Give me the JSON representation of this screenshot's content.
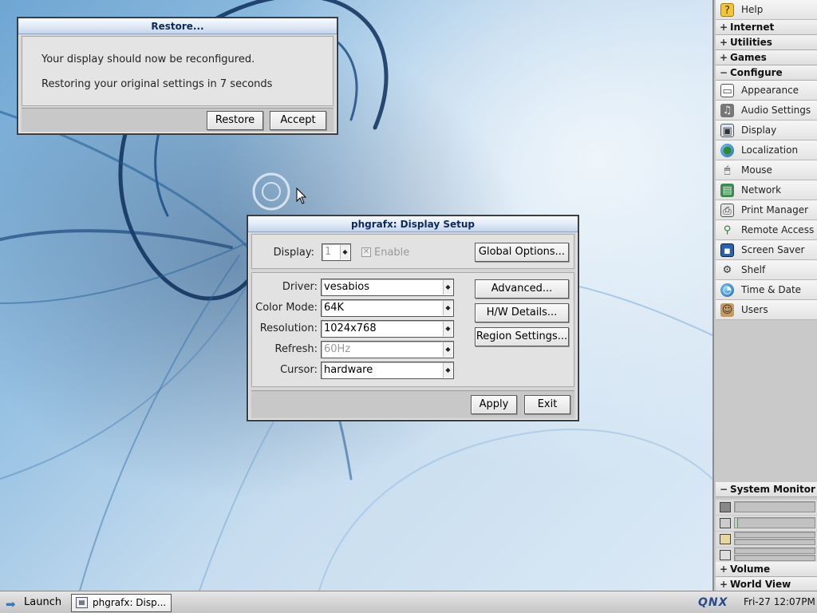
{
  "restore_dialog": {
    "title": "Restore...",
    "message_1": "Your display should now be reconfigured.",
    "message_2": "Restoring your original settings in 7 seconds",
    "restore_label": "Restore",
    "accept_label": "Accept"
  },
  "display_setup": {
    "title": "phgrafx: Display Setup",
    "display_label": "Display:",
    "display_value": "1",
    "enable_label": "Enable",
    "global_options_label": "Global Options...",
    "driver_label": "Driver:",
    "driver_value": "vesabios",
    "color_mode_label": "Color Mode:",
    "color_mode_value": "64K",
    "resolution_label": "Resolution:",
    "resolution_value": "1024x768",
    "refresh_label": "Refresh:",
    "refresh_value": "60Hz",
    "cursor_label": "Cursor:",
    "cursor_value": "hardware",
    "advanced_label": "Advanced...",
    "hw_details_label": "H/W Details...",
    "region_settings_label": "Region Settings...",
    "apply_label": "Apply",
    "exit_label": "Exit"
  },
  "shelf": {
    "help": "Help",
    "internet": "Internet",
    "utilities": "Utilities",
    "games": "Games",
    "configure": "Configure",
    "expand_glyph": "+",
    "collapse_glyph": "−",
    "configure_items": [
      {
        "label": "Appearance",
        "icon": "appearance-icon"
      },
      {
        "label": "Audio Settings",
        "icon": "audio-icon"
      },
      {
        "label": "Display",
        "icon": "display-icon"
      },
      {
        "label": "Localization",
        "icon": "globe-icon"
      },
      {
        "label": "Mouse",
        "icon": "mouse-icon"
      },
      {
        "label": "Network",
        "icon": "network-icon"
      },
      {
        "label": "Print Manager",
        "icon": "printer-icon"
      },
      {
        "label": "Remote Access",
        "icon": "remote-access-icon"
      },
      {
        "label": "Screen Saver",
        "icon": "screen-saver-icon"
      },
      {
        "label": "Shelf",
        "icon": "shelf-icon"
      },
      {
        "label": "Time & Date",
        "icon": "clock-globe-icon"
      },
      {
        "label": "Users",
        "icon": "users-icon"
      }
    ],
    "system_monitor": "System Monitor",
    "system_monitor_levels": [
      0.0,
      0.04,
      0.0,
      0.0
    ],
    "volume": "Volume",
    "world_view": "World View"
  },
  "taskbar": {
    "launch_label": "Launch",
    "task_label": "phgrafx: Disp...",
    "logo": "QNX",
    "clock": "Fri-27 12:07PM"
  }
}
